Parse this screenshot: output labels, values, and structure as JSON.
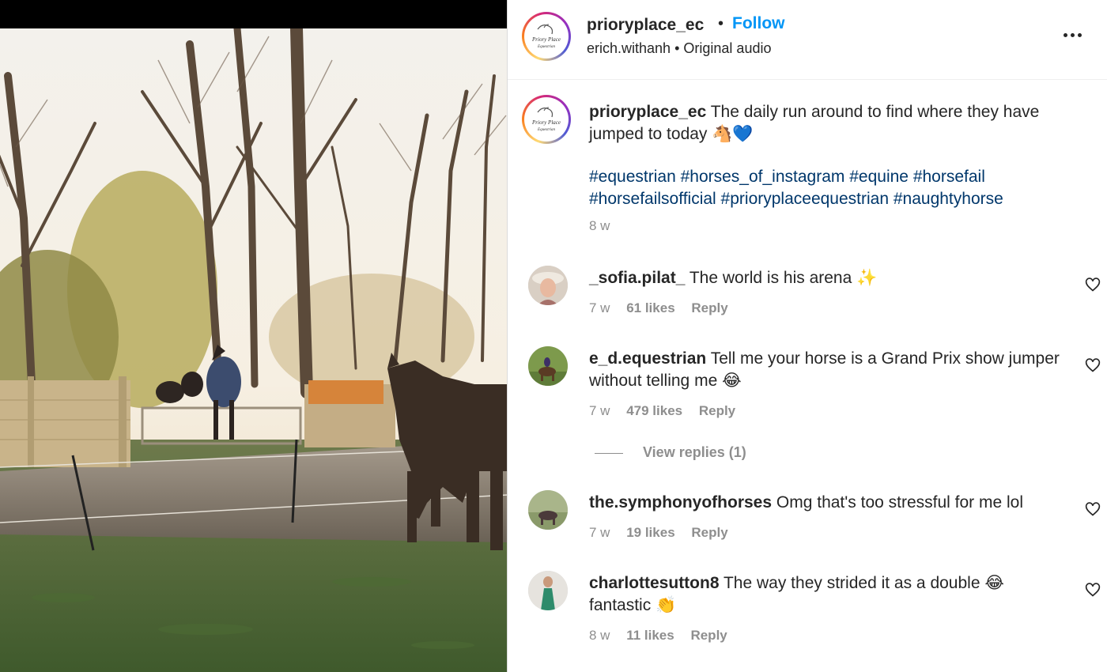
{
  "post": {
    "username": "prioryplace_ec",
    "dot": "•",
    "follow_label": "Follow",
    "audio_user": "erich.withanh",
    "audio_sep": "•",
    "audio_label": "Original audio",
    "avatar_logo_text_1": "Priory Place",
    "avatar_logo_text_2": "Equestrian"
  },
  "caption": {
    "username": "prioryplace_ec",
    "text": "The daily run around to find where they have jumped to today 🐴💙",
    "hashtags": [
      "#equestrian",
      "#horses_of_instagram",
      "#equine",
      "#horsefail",
      "#horsefailsofficial",
      "#prioryplaceequestrian",
      "#naughtyhorse"
    ],
    "time": "8 w"
  },
  "comments": [
    {
      "username": "_sofia.pilat_",
      "text": "The world is his arena ✨",
      "time": "7 w",
      "likes": "61 likes",
      "reply": "Reply"
    },
    {
      "username": "e_d.equestrian",
      "text": "Tell me your horse is a Grand Prix show jumper without telling me 😂",
      "time": "7 w",
      "likes": "479 likes",
      "reply": "Reply"
    },
    {
      "username": "the.symphonyofhorses",
      "text": "Omg that's too stressful for me lol",
      "time": "7 w",
      "likes": "19 likes",
      "reply": "Reply"
    },
    {
      "username": "charlottesutton8",
      "text": "The way they strided it as a double 😂 fantastic 👏",
      "time": "8 w",
      "likes": "11 likes",
      "reply": "Reply"
    }
  ],
  "view_replies_label": "View replies (1)",
  "colors": {
    "link_blue": "#0095f6",
    "hashtag_blue": "#00376b",
    "muted": "#8e8e8e",
    "text": "#262626"
  },
  "icons": {
    "more": "more-horizontal-icon",
    "like": "heart-outline-icon"
  }
}
